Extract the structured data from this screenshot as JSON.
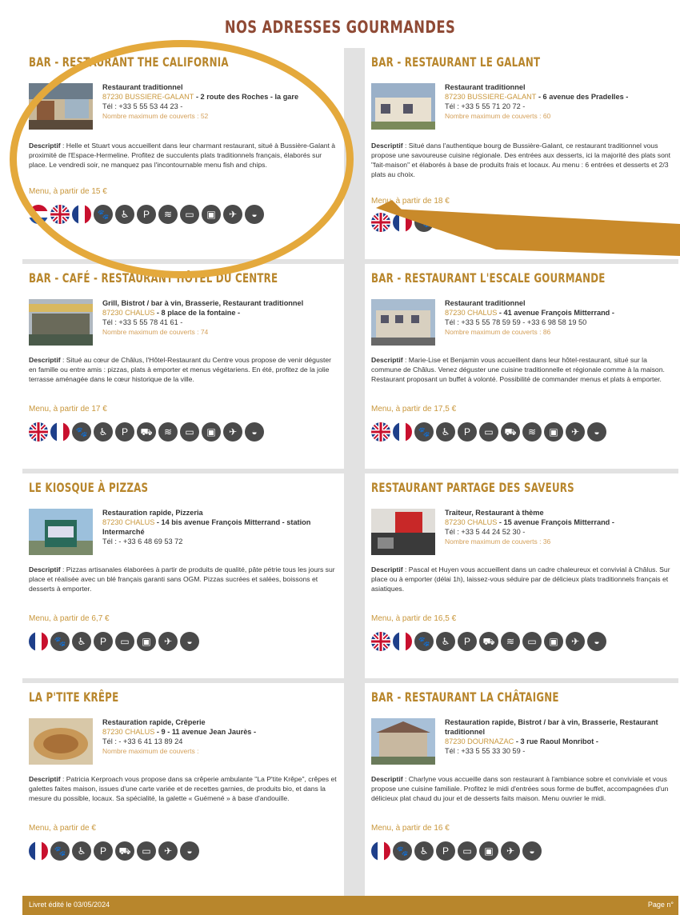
{
  "page": {
    "title": "NOS ADRESSES GOURMANDES",
    "footer_left": "Livret édité le 03/05/2024",
    "footer_right": "Page n°"
  },
  "colors": {
    "title": "#8f4a35",
    "accent": "#b8862c",
    "annotation": "#e4a93c",
    "icon": "#4a4a4a"
  },
  "restaurants": [
    {
      "name": "BAR - RESTAURANT THE CALIFORNIA",
      "category": "Restaurant traditionnel",
      "zip_city": "87230 BUSSIERE-GALANT",
      "street": " - 2 route des Roches - la gare",
      "tel": "Tél : +33 5 55 53 44 23 -",
      "covers": "Nombre maximum de couverts : 52",
      "desc_label": "Descriptif",
      "desc": " : Helle et Stuart vous accueillent dans leur charmant restaurant, situé à Bussière-Galant à proximité de l'Espace-Hermeline. Profitez de succulents plats traditionnels français, élaborés sur place. Le vendredi soir, ne manquez pas l'incontournable menu fish and chips.",
      "menu": "Menu, à partir de 15 €",
      "icons": [
        "flag-nl",
        "flag-uk",
        "flag-fr",
        "pet-icon",
        "accessible-icon",
        "parking-icon",
        "wifi-icon",
        "card-icon",
        "wash-icon",
        "bird-icon",
        "chef-icon"
      ]
    },
    {
      "name": "BAR - RESTAURANT LE GALANT",
      "category": "Restaurant traditionnel",
      "zip_city": "87230 BUSSIERE-GALANT",
      "street": " - 6 avenue des Pradelles -",
      "tel": "Tél : +33 5 55 71 20 72 -",
      "covers": "Nombre maximum de couverts : 60",
      "desc_label": "Descriptif",
      "desc": " : Situé dans l'authentique bourg de Bussière-Galant, ce restaurant traditionnel vous propose une savoureuse cuisine régionale. Des entrées aux desserts, ici la majorité des plats sont \"fait-maison\" et élaborés à base de produits frais et locaux. Au menu : 6 entrées et desserts et 2/3 plats au choix.",
      "menu": "Menu, à partir de 18 €",
      "icons": [
        "flag-uk",
        "flag-fr"
      ]
    },
    {
      "name": "BAR - CAFÉ - RESTAURANT HÔTEL DU CENTRE",
      "category": "Grill, Bistrot / bar à vin, Brasserie, Restaurant traditionnel",
      "zip_city": "87230 CHALUS",
      "street": " - 8 place de la fontaine -",
      "tel": "Tél : +33 5 55 78 41 61 -",
      "covers": "Nombre maximum de couverts : 74",
      "desc_label": "Descriptif",
      "desc": " : Situé au cœur de Châlus, l'Hôtel-Restaurant du Centre vous propose de venir déguster en famille ou entre amis : pizzas, plats à emporter et menus végétariens. En été, profitez de la jolie terrasse aménagée dans le cœur historique de la ville.",
      "menu": "Menu, à partir de 17 €",
      "icons": [
        "flag-uk",
        "flag-fr",
        "pet-icon",
        "accessible-icon",
        "parking-icon",
        "car-icon",
        "wifi-icon",
        "card-icon",
        "wash-icon",
        "bird-icon",
        "chef-icon"
      ]
    },
    {
      "name": "BAR - RESTAURANT L'ESCALE GOURMANDE",
      "category": "Restaurant traditionnel",
      "zip_city": "87230 CHALUS",
      "street": " - 41 avenue François Mitterrand -",
      "tel": "Tél : +33 5 55 78 59 59 - +33 6 98 58 19 50",
      "covers": "Nombre maximum de couverts : 86",
      "desc_label": "Descriptif",
      "desc": " : Marie-Lise et Benjamin vous accueillent dans leur hôtel-restaurant, situé sur la commune de Châlus. Venez déguster une cuisine traditionnelle et régionale comme à la maison. Restaurant proposant un buffet à volonté. Possibilité de commander menus et plats à emporter.",
      "menu": "Menu, à partir de 17,5 €",
      "icons": [
        "flag-uk",
        "flag-fr",
        "pet-icon",
        "accessible-icon",
        "parking-icon",
        "card-icon",
        "car-icon",
        "wifi-icon",
        "wash-icon",
        "bird-icon",
        "chef-icon"
      ]
    },
    {
      "name": "LE KIOSQUE À PIZZAS",
      "category": "Restauration rapide, Pizzeria",
      "zip_city": "87230 CHALUS",
      "street": " - 14 bis avenue François Mitterrand - station Intermarché",
      "tel": "Tél : - +33 6 48 69 53 72",
      "covers": "",
      "desc_label": "Descriptif",
      "desc": " : Pizzas artisanales élaborées à partir de produits de qualité, pâte pétrie tous les jours sur place et réalisée avec un blé français garanti sans OGM. Pizzas sucrées et salées, boissons et desserts à emporter.",
      "menu": "Menu, à partir de 6,7 €",
      "icons": [
        "flag-fr",
        "pet-icon",
        "accessible-icon",
        "parking-icon",
        "card-icon",
        "wash-icon",
        "bird-icon",
        "chef-icon"
      ]
    },
    {
      "name": "RESTAURANT PARTAGE DES SAVEURS",
      "category": "Traiteur, Restaurant à thème",
      "zip_city": "87230 CHALUS",
      "street": " - 15 avenue François Mitterrand -",
      "tel": "Tél : +33 5 44 24 52 30 -",
      "covers": "Nombre maximum de couverts : 36",
      "desc_label": "Descriptif",
      "desc": " : Pascal et Huyen vous accueillent dans un cadre chaleureux et convivial à Châlus. Sur place ou à emporter (délai 1h), laissez-vous séduire par de délicieux plats traditionnels français et asiatiques.",
      "menu": "Menu, à partir de 16,5 €",
      "icons": [
        "flag-uk",
        "flag-fr",
        "pet-icon",
        "accessible-icon",
        "parking-icon",
        "car-icon",
        "wifi-icon",
        "card-icon",
        "wash-icon",
        "bird-icon",
        "chef-icon"
      ]
    },
    {
      "name": "LA P'TITE KRÊPE",
      "category": "Restauration rapide, Crêperie",
      "zip_city": "87230 CHALUS",
      "street": " - 9 - 11 avenue Jean Jaurès -",
      "tel": "Tél : - +33 6 41 13 89 24",
      "covers": "Nombre maximum de couverts :",
      "desc_label": "Descriptif",
      "desc": " : Patricia Kerproach vous propose dans sa crêperie ambulante \"La P'tite Krêpe\", crêpes et galettes faites maison, issues d'une carte variée et de recettes garnies, de produits bio, et dans la mesure du possible, locaux. Sa spécialité, la galette « Guémené » à base d'andouille.",
      "menu": "Menu, à partir de €",
      "icons": [
        "flag-fr",
        "pet-icon",
        "accessible-icon",
        "parking-icon",
        "car-icon",
        "card-icon",
        "bird-icon",
        "chef-icon"
      ]
    },
    {
      "name": "BAR - RESTAURANT LA CHÂTAIGNE",
      "category": "Restauration rapide, Bistrot / bar à vin, Brasserie, Restaurant traditionnel",
      "zip_city": "87230 DOURNAZAC",
      "street": " - 3 rue Raoul Monribot -",
      "tel": "Tél : +33 5 55 33 30 59 -",
      "covers": "",
      "desc_label": "Descriptif",
      "desc": " : Charlyne vous accueille dans son restaurant à l'ambiance sobre et conviviale et vous propose une cuisine familiale. Profitez le midi d'entrées sous forme de buffet, accompagnées d'un délicieux plat chaud du jour et de desserts faits maison. Menu ouvrier le midi.",
      "menu": "Menu, à partir de 16 €",
      "icons": [
        "flag-fr",
        "pet-icon",
        "accessible-icon",
        "parking-icon",
        "card-icon",
        "wash-icon",
        "bird-icon",
        "chef-icon"
      ]
    }
  ]
}
